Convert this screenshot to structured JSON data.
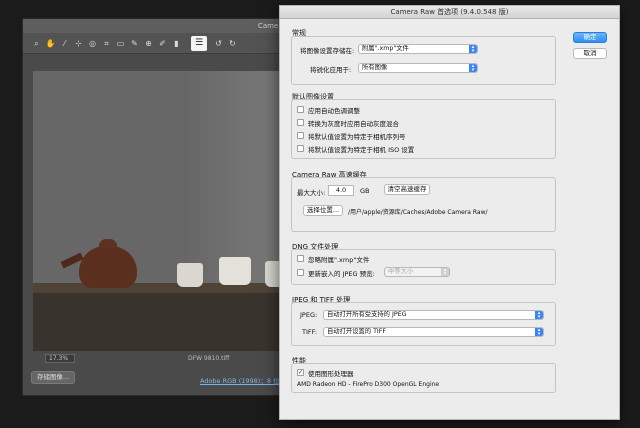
{
  "background_window": {
    "title": "Came",
    "zoom": "17.3%",
    "filename": "DFW 9810.tiff",
    "save_button": "存储图像...",
    "footer_link": "Adobe RGB (1998)；8 位；"
  },
  "dialog": {
    "title": "Camera Raw 首选项 (9.4.0.548 版)",
    "ok_button": "确定",
    "cancel_button": "取消",
    "general": {
      "title": "常规",
      "save_label": "将图像设置存储在:",
      "save_value": "附属\".xmp\"文件",
      "sharpen_label": "将锐化应用于:",
      "sharpen_value": "所有图像"
    },
    "defaults": {
      "title": "默认图像设置",
      "options": [
        {
          "label": "应用自动色调调整",
          "checked": false
        },
        {
          "label": "转换为灰度时应用自动灰度混合",
          "checked": false
        },
        {
          "label": "将默认值设置为特定于相机序列号",
          "checked": false
        },
        {
          "label": "将默认值设置为特定于相机 ISO 设置",
          "checked": false
        }
      ]
    },
    "cache": {
      "title": "Camera Raw 高速缓存",
      "max_label": "最大大小:",
      "max_value": "4.0",
      "unit": "GB",
      "purge_button": "清空高速缓存",
      "location_button": "选择位置...",
      "path": "/用户/apple/资源库/Caches/Adobe Camera Raw/"
    },
    "dng": {
      "title": "DNG 文件处理",
      "ignore_label": "忽略附属\".xmp\"文件",
      "ignore_checked": false,
      "update_label": "更新嵌入的 JPEG 预览:",
      "update_checked": false,
      "preview_value": "中等大小"
    },
    "jpeg_tiff": {
      "title": "JPEG 和 TIFF 处理",
      "jpeg_label": "JPEG:",
      "jpeg_value": "自动打开所有受支持的 JPEG",
      "tiff_label": "TIFF:",
      "tiff_value": "自动打开设置的 TIFF"
    },
    "performance": {
      "title": "性能",
      "gpu_label": "使用图形处理器",
      "gpu_checked": true,
      "gpu_name": "AMD Radeon HD - FirePro D300 OpenGL Engine"
    }
  },
  "icons": [
    "zoom-icon",
    "hand-icon",
    "white-balance-icon",
    "color-sampler-icon",
    "target-adjust-icon",
    "crop-icon",
    "straighten-icon",
    "spot-removal-icon",
    "red-eye-icon",
    "adjustment-brush-icon",
    "graduated-filter-icon",
    "radial-filter-icon",
    "preferences-icon",
    "rotate-ccw-icon",
    "rotate-cw-icon"
  ]
}
